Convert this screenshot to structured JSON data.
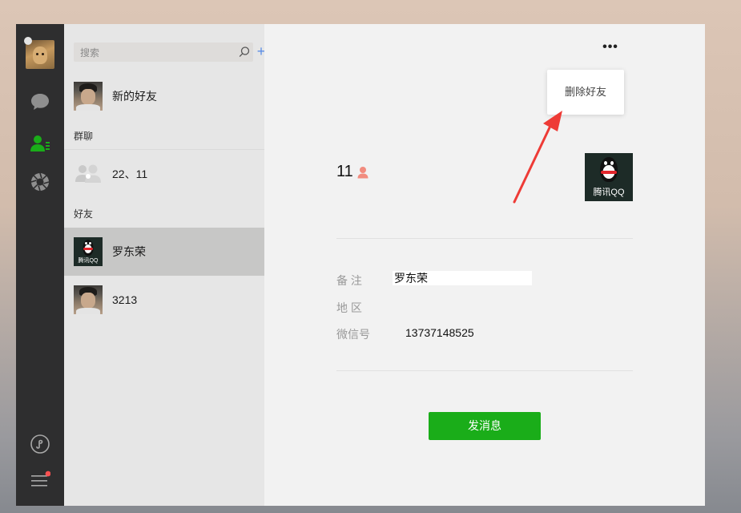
{
  "nav": {
    "user_avatar": "cat-avatar",
    "items": [
      "chat-icon",
      "contacts-icon",
      "moments-icon"
    ],
    "bottom_items": [
      "mini-program-icon",
      "menu-icon"
    ],
    "accent_color": "#1aad19",
    "badge_color": "#fa5151"
  },
  "search": {
    "placeholder": "搜索",
    "add_label": "+"
  },
  "contacts": {
    "new_friends": {
      "name": "新的好友",
      "avatar": "boy-photo-avatar"
    },
    "group_section_label": "群聊",
    "groups": [
      {
        "name": "22、11",
        "avatar": "group-icon"
      }
    ],
    "friends_section_label": "好友",
    "friends": [
      {
        "name": "罗东荣",
        "avatar": "qq-penguin-avatar",
        "selected": true
      },
      {
        "name": "3213",
        "avatar": "boy-photo-avatar",
        "selected": false
      }
    ]
  },
  "detail": {
    "more_label": "•••",
    "popup_item": "删除好友",
    "display_name": "11",
    "gender": "female",
    "avatar_caption": "腾讯QQ",
    "fields": {
      "remark_label": "备 注",
      "remark_value": "罗东荣",
      "region_label": "地 区",
      "region_value": "",
      "wechat_id_label": "微信号",
      "wechat_id_value": "13737148525"
    },
    "send_button": "发消息"
  }
}
